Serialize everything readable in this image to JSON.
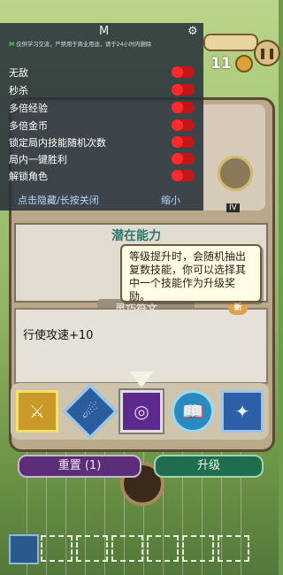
{
  "hud": {
    "coin_count": "11",
    "pause_icon": "pause-icon"
  },
  "panel": {
    "potential_title": "潜在能力",
    "tooltip": "等级提升时，会随机抽出复数技能，你可以选择其中一个技能作为升级奖励。",
    "rune_label": "灵巧符文",
    "new_badge": "新",
    "skill_desc": "行使攻速+10",
    "roman": "IV"
  },
  "skills": [
    {
      "name": "golden-sword-skill",
      "glyph": "⚔"
    },
    {
      "name": "wind-slash-skill",
      "glyph": "☄"
    },
    {
      "name": "purple-vortex-skill",
      "glyph": "◎"
    },
    {
      "name": "spellbook-skill",
      "glyph": "📖"
    },
    {
      "name": "ice-trident-skill",
      "glyph": "✦"
    }
  ],
  "actions": {
    "reset_label": "重置 (1)",
    "upgrade_label": "升级"
  },
  "mod_menu": {
    "title": "M",
    "notice_prefix": "M",
    "notice": "仅供学习交流，严禁用于商业用途，请于24小时内删除",
    "options": [
      "无敌",
      "秒杀",
      "多倍经验",
      "多倍金币",
      "锁定局内技能随机次数",
      "局内一键胜利",
      "解锁角色"
    ],
    "hide_label": "点击隐藏/长按关闭",
    "minimize_label": "缩小"
  },
  "colors": {
    "menu_bg": "#28323a",
    "toggle_on": "#ff2a2a",
    "teal_title": "#2c7a6b"
  }
}
